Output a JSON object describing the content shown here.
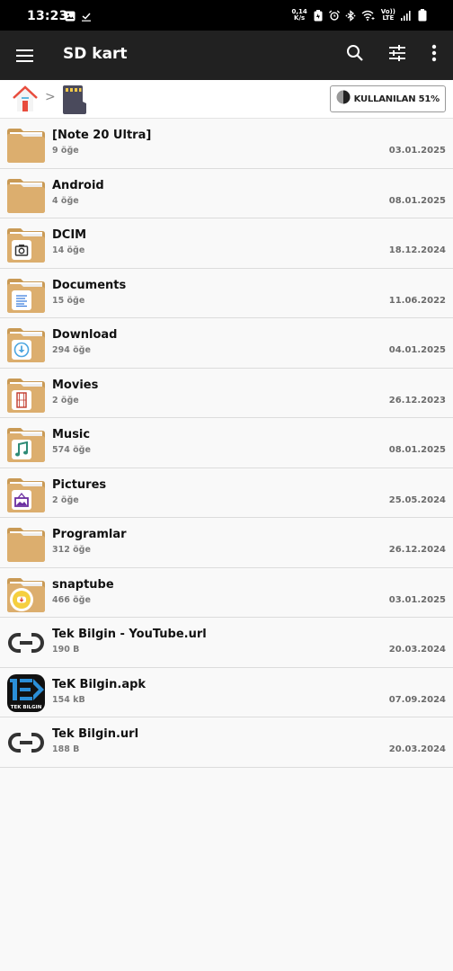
{
  "status_bar": {
    "time": "13:23",
    "left_icons": [
      "gallery-icon",
      "download-done-icon"
    ],
    "net_speed_value": "0,14",
    "net_speed_unit": "K/s",
    "right_icons": [
      "battery-saver-icon",
      "alarm-icon",
      "bluetooth-icon",
      "wifi-icon",
      "volte-icon",
      "signal-icon",
      "battery-icon"
    ],
    "volte_top": "Vo))",
    "volte_bottom": "LTE"
  },
  "app_bar": {
    "title": "SD kart",
    "menu_icon": "hamburger-menu-icon",
    "actions": [
      "search-icon",
      "filter-settings-icon",
      "more-vert-icon"
    ]
  },
  "path_bar": {
    "crumbs": [
      "home",
      "sd-card"
    ],
    "separator": ">",
    "usage_label": "KULLANILAN 51%",
    "usage_percent": 51
  },
  "colors": {
    "folder": "#dcae6e",
    "folder_dark": "#c99a55",
    "appbar": "#212121",
    "statusbar": "#000000"
  },
  "items": [
    {
      "name": "[Note 20 Ultra]",
      "sub": "9 öğe",
      "date": "03.01.2025",
      "type": "folder",
      "badge": ""
    },
    {
      "name": "Android",
      "sub": "4 öğe",
      "date": "08.01.2025",
      "type": "folder",
      "badge": ""
    },
    {
      "name": "DCIM",
      "sub": "14 öğe",
      "date": "18.12.2024",
      "type": "folder",
      "badge": "camera"
    },
    {
      "name": "Documents",
      "sub": "15 öğe",
      "date": "11.06.2022",
      "type": "folder",
      "badge": "document"
    },
    {
      "name": "Download",
      "sub": "294 öğe",
      "date": "04.01.2025",
      "type": "folder",
      "badge": "download"
    },
    {
      "name": "Movies",
      "sub": "2 öğe",
      "date": "26.12.2023",
      "type": "folder",
      "badge": "film"
    },
    {
      "name": "Music",
      "sub": "574 öğe",
      "date": "08.01.2025",
      "type": "folder",
      "badge": "music"
    },
    {
      "name": "Pictures",
      "sub": "2 öğe",
      "date": "25.05.2024",
      "type": "folder",
      "badge": "picture"
    },
    {
      "name": "Programlar",
      "sub": "312 öğe",
      "date": "26.12.2024",
      "type": "folder",
      "badge": ""
    },
    {
      "name": "snaptube",
      "sub": "466 öğe",
      "date": "03.01.2025",
      "type": "folder",
      "badge": "snaptube"
    },
    {
      "name": "Tek Bilgin - YouTube.url",
      "sub": "190 B",
      "date": "20.03.2024",
      "type": "link",
      "badge": ""
    },
    {
      "name": "TeK Bilgin.apk",
      "sub": "154 kB",
      "date": "07.09.2024",
      "type": "apk",
      "badge": "",
      "apk_caption": "TEK BILGIN"
    },
    {
      "name": "Tek Bilgin.url",
      "sub": "188 B",
      "date": "20.03.2024",
      "type": "link",
      "badge": ""
    }
  ]
}
